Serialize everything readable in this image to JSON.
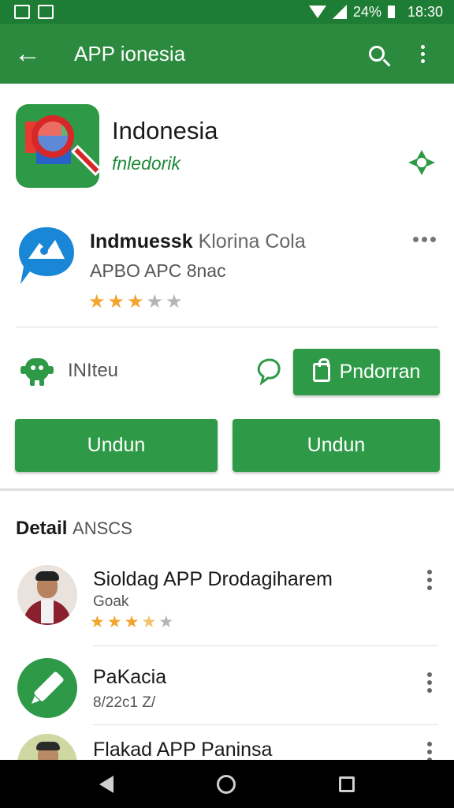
{
  "status": {
    "battery": "24%",
    "time": "18:30"
  },
  "appbar": {
    "title": "APP ionesia"
  },
  "hero": {
    "title": "Indonesia",
    "subtitle": "fnledorik"
  },
  "app2": {
    "title_bold": "Indmuessk",
    "title_rest": "Klorina Cola",
    "subtitle": "APBO APC 8nac",
    "rating": 3
  },
  "actions": {
    "label": "INIteu",
    "pending_label": "Pndorran",
    "install1": "Undun",
    "install2": "Undun"
  },
  "details": {
    "title_bold": "Detail",
    "title_rest": "ANSCS",
    "rows": [
      {
        "title": "Sioldag APP Drodagiharem",
        "subtitle": "Goak",
        "rating": 3.5
      },
      {
        "title": "PaKacia",
        "subtitle": "8/22c1 Z/"
      },
      {
        "title": "Flakad APP Paninsa"
      }
    ]
  },
  "colors": {
    "primary": "#2b8a3e",
    "status": "#1e7d34",
    "star": "#f2a42c"
  }
}
